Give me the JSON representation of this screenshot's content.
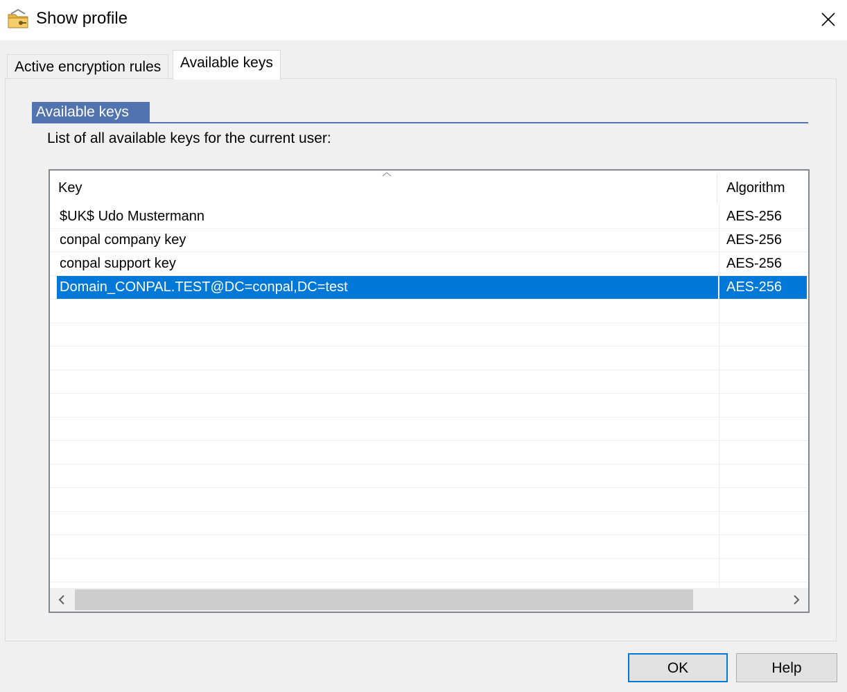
{
  "window": {
    "title": "Show profile",
    "icon": "folder-key-icon",
    "close": "close-icon"
  },
  "tabs": [
    {
      "label": "Active encryption rules",
      "active": false
    },
    {
      "label": "Available keys",
      "active": true
    }
  ],
  "group": {
    "title": "Available keys",
    "description": "List of all available keys for the current user:"
  },
  "table": {
    "columns": [
      "Key",
      "Algorithm"
    ],
    "sort_indicator": "^",
    "rows": [
      {
        "key": "$UK$ Udo Mustermann",
        "algorithm": "AES-256",
        "selected": false
      },
      {
        "key": "conpal company key",
        "algorithm": "AES-256",
        "selected": false
      },
      {
        "key": "conpal support key",
        "algorithm": "AES-256",
        "selected": false
      },
      {
        "key": "Domain_CONPAL.TEST@DC=conpal,DC=test",
        "algorithm": "AES-256",
        "selected": true
      }
    ]
  },
  "buttons": {
    "ok": "OK",
    "help": "Help"
  },
  "colors": {
    "accent": "#0078d7",
    "group_header": "#5173b0"
  }
}
